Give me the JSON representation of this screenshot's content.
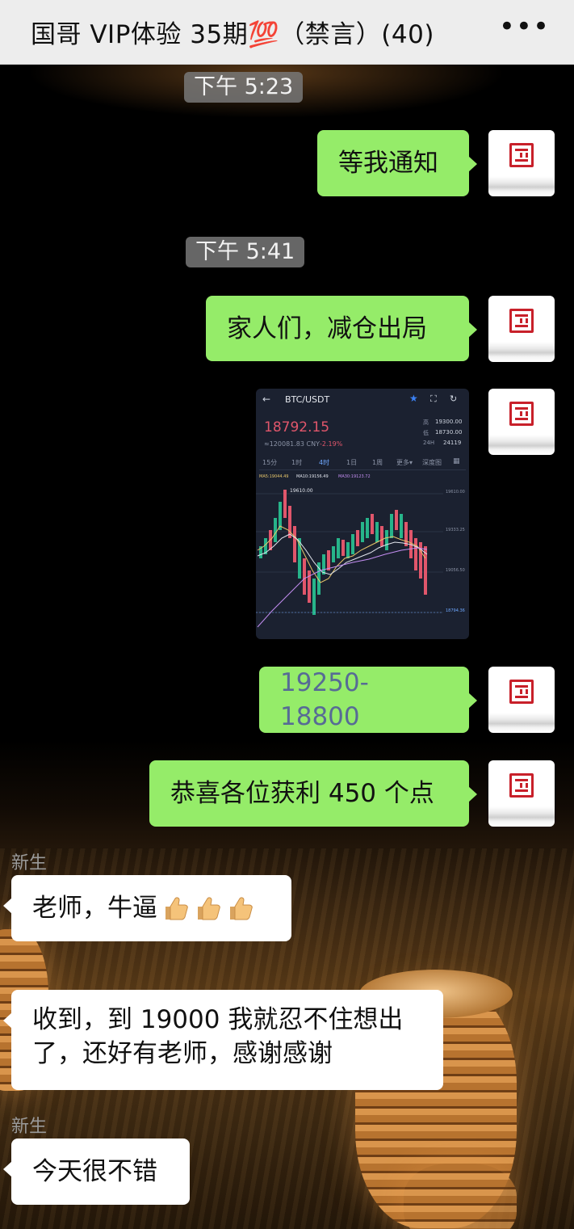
{
  "header": {
    "title": "国哥 VIP体验 35期💯（禁言）(40)",
    "more_icon": "more-dots-icon",
    "more_label": "•••"
  },
  "colors": {
    "header_bg": "#ededed",
    "outgoing_bubble": "#95ec69",
    "incoming_bubble": "#ffffff",
    "timestamp_bg": "#7a7a7a",
    "link_text": "#576b95",
    "price_red": "#e0566b"
  },
  "timestamps": [
    "下午 5:23",
    "下午 5:41"
  ],
  "outgoing": {
    "m1": "等我通知",
    "m2": "家人们，减仓出局",
    "m4": "19250-18800",
    "m5": "恭喜各位获利 450 个点"
  },
  "incoming": [
    {
      "sender": "新生",
      "text": "老师，牛逼",
      "emoji": "👍👍👍"
    },
    {
      "sender": "",
      "text": "收到，到 19000 我就忍不住想出了，还好有老师，感谢感谢"
    },
    {
      "sender": "新生",
      "text": "今天很不错"
    }
  ],
  "trade_screenshot": {
    "pair": "BTC/USDT",
    "price": "18792.15",
    "cny": "≈120081.83 CNY",
    "change": "-2.19%",
    "high_label": "高",
    "high": "19300.00",
    "low_label": "低",
    "low": "18730.00",
    "vol_label": "24H",
    "vol": "24119",
    "tabs": [
      "15分",
      "1时",
      "4时",
      "1日",
      "1周",
      "更多▾",
      "深度图"
    ],
    "ma5": "MA5:19044.49",
    "ma10": "MA10:19156.49",
    "ma30": "MA30:19123.72",
    "peak_label": "19610.00",
    "axis": [
      "19610.00",
      "19333.25",
      "19056.50",
      "18794.36"
    ]
  }
}
